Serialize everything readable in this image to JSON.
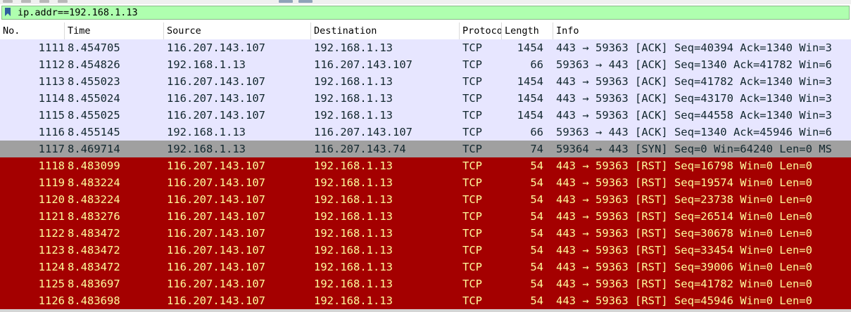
{
  "filter": {
    "value": "ip.addr==192.168.1.13"
  },
  "columns": [
    "No.",
    "Time",
    "Source",
    "Destination",
    "Protocol",
    "Length",
    "Info"
  ],
  "colors": {
    "ack_bg": "#e7e6ff",
    "syn_bg": "#a0a0a0",
    "rst_bg": "#a40000",
    "rst_fg": "#fffc9c",
    "filter_bg": "#afffaf"
  },
  "packets": [
    {
      "no": "1111",
      "time": "8.454705",
      "src": "116.207.143.107",
      "dst": "192.168.1.13",
      "proto": "TCP",
      "len": "1454",
      "info": "443 → 59363 [ACK] Seq=40394 Ack=1340 Win=3",
      "kind": "ack"
    },
    {
      "no": "1112",
      "time": "8.454826",
      "src": "192.168.1.13",
      "dst": "116.207.143.107",
      "proto": "TCP",
      "len": "66",
      "info": "59363 → 443 [ACK] Seq=1340 Ack=41782 Win=6",
      "kind": "ack"
    },
    {
      "no": "1113",
      "time": "8.455023",
      "src": "116.207.143.107",
      "dst": "192.168.1.13",
      "proto": "TCP",
      "len": "1454",
      "info": "443 → 59363 [ACK] Seq=41782 Ack=1340 Win=3",
      "kind": "ack"
    },
    {
      "no": "1114",
      "time": "8.455024",
      "src": "116.207.143.107",
      "dst": "192.168.1.13",
      "proto": "TCP",
      "len": "1454",
      "info": "443 → 59363 [ACK] Seq=43170 Ack=1340 Win=3",
      "kind": "ack"
    },
    {
      "no": "1115",
      "time": "8.455025",
      "src": "116.207.143.107",
      "dst": "192.168.1.13",
      "proto": "TCP",
      "len": "1454",
      "info": "443 → 59363 [ACK] Seq=44558 Ack=1340 Win=3",
      "kind": "ack"
    },
    {
      "no": "1116",
      "time": "8.455145",
      "src": "192.168.1.13",
      "dst": "116.207.143.107",
      "proto": "TCP",
      "len": "66",
      "info": "59363 → 443 [ACK] Seq=1340 Ack=45946 Win=6",
      "kind": "ack"
    },
    {
      "no": "1117",
      "time": "8.469714",
      "src": "192.168.1.13",
      "dst": "116.207.143.74",
      "proto": "TCP",
      "len": "74",
      "info": "59364 → 443 [SYN] Seq=0 Win=64240 Len=0 MS",
      "kind": "syn"
    },
    {
      "no": "1118",
      "time": "8.483099",
      "src": "116.207.143.107",
      "dst": "192.168.1.13",
      "proto": "TCP",
      "len": "54",
      "info": "443 → 59363 [RST] Seq=16798 Win=0 Len=0",
      "kind": "rst"
    },
    {
      "no": "1119",
      "time": "8.483224",
      "src": "116.207.143.107",
      "dst": "192.168.1.13",
      "proto": "TCP",
      "len": "54",
      "info": "443 → 59363 [RST] Seq=19574 Win=0 Len=0",
      "kind": "rst"
    },
    {
      "no": "1120",
      "time": "8.483224",
      "src": "116.207.143.107",
      "dst": "192.168.1.13",
      "proto": "TCP",
      "len": "54",
      "info": "443 → 59363 [RST] Seq=23738 Win=0 Len=0",
      "kind": "rst"
    },
    {
      "no": "1121",
      "time": "8.483276",
      "src": "116.207.143.107",
      "dst": "192.168.1.13",
      "proto": "TCP",
      "len": "54",
      "info": "443 → 59363 [RST] Seq=26514 Win=0 Len=0",
      "kind": "rst"
    },
    {
      "no": "1122",
      "time": "8.483472",
      "src": "116.207.143.107",
      "dst": "192.168.1.13",
      "proto": "TCP",
      "len": "54",
      "info": "443 → 59363 [RST] Seq=30678 Win=0 Len=0",
      "kind": "rst"
    },
    {
      "no": "1123",
      "time": "8.483472",
      "src": "116.207.143.107",
      "dst": "192.168.1.13",
      "proto": "TCP",
      "len": "54",
      "info": "443 → 59363 [RST] Seq=33454 Win=0 Len=0",
      "kind": "rst"
    },
    {
      "no": "1124",
      "time": "8.483472",
      "src": "116.207.143.107",
      "dst": "192.168.1.13",
      "proto": "TCP",
      "len": "54",
      "info": "443 → 59363 [RST] Seq=39006 Win=0 Len=0",
      "kind": "rst"
    },
    {
      "no": "1125",
      "time": "8.483697",
      "src": "116.207.143.107",
      "dst": "192.168.1.13",
      "proto": "TCP",
      "len": "54",
      "info": "443 → 59363 [RST] Seq=41782 Win=0 Len=0",
      "kind": "rst"
    },
    {
      "no": "1126",
      "time": "8.483698",
      "src": "116.207.143.107",
      "dst": "192.168.1.13",
      "proto": "TCP",
      "len": "54",
      "info": "443 → 59363 [RST] Seq=45946 Win=0 Len=0",
      "kind": "rst"
    }
  ]
}
